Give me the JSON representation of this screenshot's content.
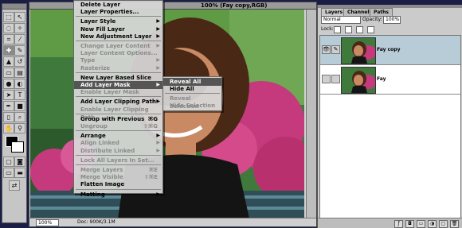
{
  "image_window": {
    "title": "100% (Fay copy,RGB)",
    "zoom": "100%",
    "doc_info": "Doc: 900K/3.1M"
  },
  "layer_menu": {
    "items": [
      {
        "label": "Delete Layer",
        "enabled": true
      },
      {
        "label": "Layer Properties...",
        "enabled": true
      },
      {
        "label": "Layer Style",
        "enabled": true,
        "submenu": true
      },
      {
        "label": "New Fill Layer",
        "enabled": true,
        "submenu": true
      },
      {
        "label": "New Adjustment Layer",
        "enabled": true,
        "submenu": true
      },
      {
        "label": "Change Layer Content",
        "enabled": false,
        "submenu": true
      },
      {
        "label": "Layer Content Options...",
        "enabled": false
      },
      {
        "label": "Type",
        "enabled": false,
        "submenu": true
      },
      {
        "label": "Rasterize",
        "enabled": false,
        "submenu": true
      },
      {
        "label": "New Layer Based Slice",
        "enabled": true
      },
      {
        "label": "Add Layer Mask",
        "enabled": true,
        "submenu": true,
        "highlighted": true
      },
      {
        "label": "Enable Layer Mask",
        "enabled": false
      },
      {
        "label": "Add Layer Clipping Path",
        "enabled": true,
        "submenu": true
      },
      {
        "label": "Enable Layer Clipping Path",
        "enabled": false
      },
      {
        "label": "Group with Previous",
        "enabled": true,
        "shortcut": "⌘G"
      },
      {
        "label": "Ungroup",
        "enabled": false,
        "shortcut": "⇧⌘G"
      },
      {
        "label": "Arrange",
        "enabled": true,
        "submenu": true
      },
      {
        "label": "Align Linked",
        "enabled": false,
        "submenu": true
      },
      {
        "label": "Distribute Linked",
        "enabled": false,
        "submenu": true
      },
      {
        "label": "Lock All Layers In Set...",
        "enabled": false
      },
      {
        "label": "Merge Layers",
        "enabled": false,
        "shortcut": "⌘E"
      },
      {
        "label": "Merge Visible",
        "enabled": false,
        "shortcut": "⇧⌘E"
      },
      {
        "label": "Flatten Image",
        "enabled": true
      },
      {
        "label": "Matting",
        "enabled": true,
        "submenu": true
      }
    ]
  },
  "mask_submenu": {
    "items": [
      {
        "label": "Reveal All",
        "enabled": true,
        "highlighted": true
      },
      {
        "label": "Hide All",
        "enabled": true
      },
      {
        "label": "Reveal Selection",
        "enabled": false
      },
      {
        "label": "Hide Selection",
        "enabled": false
      }
    ]
  },
  "layers_palette": {
    "tabs": [
      "Layers",
      "Channels",
      "Paths"
    ],
    "active_tab": "Layers",
    "blend_mode": "Normal",
    "opacity_label": "Opacity:",
    "opacity_value": "100%",
    "lock_label": "Lock:",
    "layers": [
      {
        "name": "Fay copy",
        "selected": true,
        "visible": true
      },
      {
        "name": "Fay",
        "selected": false,
        "visible": false
      }
    ]
  },
  "colors": {
    "menu_highlight": "#555555",
    "selected_layer": "#b8ccd8",
    "desktop": "#1b1d46"
  }
}
